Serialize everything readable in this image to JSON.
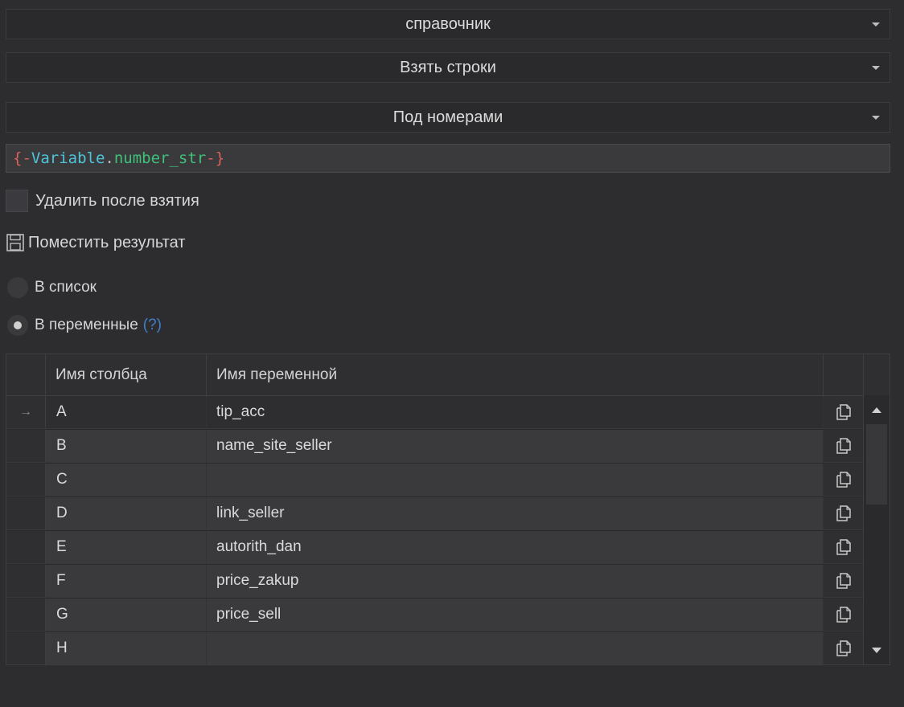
{
  "dropdowns": [
    {
      "value": "справочник"
    },
    {
      "value": "Взять строки"
    },
    {
      "value": "Под номерами"
    }
  ],
  "variable_field": {
    "open": "{-",
    "var": "Variable",
    "dot": ".",
    "name": "number_str",
    "close": "-}"
  },
  "delete_checkbox": {
    "label": "Удалить после взятия",
    "checked": false
  },
  "result_section": {
    "label": "Поместить результат",
    "icon": "save-icon"
  },
  "radios": [
    {
      "label": "В список",
      "checked": false
    },
    {
      "label": "В переменные",
      "checked": true,
      "help": "(?)"
    }
  ],
  "table": {
    "columns": [
      "Имя столбца",
      "Имя переменной"
    ],
    "rows": [
      {
        "column": "A",
        "variable": "tip_acc",
        "current": true,
        "marker": "→"
      },
      {
        "column": "B",
        "variable": "name_site_seller"
      },
      {
        "column": "C",
        "variable": ""
      },
      {
        "column": "D",
        "variable": "link_seller"
      },
      {
        "column": "E",
        "variable": "autorith_dan"
      },
      {
        "column": "F",
        "variable": "price_zakup"
      },
      {
        "column": "G",
        "variable": "price_sell"
      },
      {
        "column": "H",
        "variable": ""
      }
    ],
    "row_action_icon": "copy-icon"
  },
  "colors": {
    "background": "#2d2d30",
    "brace": "#d8625a",
    "variable": "#4fc3d9",
    "name": "#3fc079",
    "help": "#3f7fc8"
  }
}
